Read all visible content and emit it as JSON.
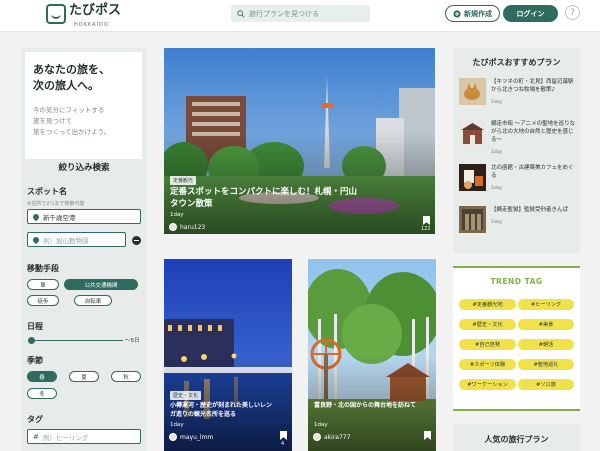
{
  "header": {
    "logo_text": "たびポス",
    "logo_sub": "HOKKAIDO",
    "search_placeholder": "旅行プランを見つける",
    "new_button": "新規作成",
    "login_button": "ログイン",
    "help": "?"
  },
  "sidebar": {
    "intro_title_1": "あなたの旅を、",
    "intro_title_2": "次の旅人へ。",
    "intro_body_1": "今の気分にフィットする",
    "intro_body_2": "旅を見つけて",
    "intro_body_3": "旅をつくって出かけよう。",
    "filter_heading": "絞り込み検索",
    "spot_label": "スポット名",
    "spot_note": "※住所で2つまで検索可能",
    "spot_1_value": "新千歳空港",
    "spot_2_placeholder": "例）旭山動物園",
    "transport_label": "移動手段",
    "transport": [
      "車",
      "公共交通機関",
      "徒歩",
      "自転車"
    ],
    "transport_selected": "公共交通機関",
    "days_label": "日程",
    "days_max": "〜5日",
    "days_value": 1,
    "season_label": "季節",
    "seasons": [
      "春",
      "夏",
      "秋",
      "冬"
    ],
    "season_selected": "春",
    "tag_label": "タグ",
    "tag_placeholder": "例）ヒーリング"
  },
  "featured": {
    "badge": "定番観光",
    "title_1": "定番スポットをコンパクトに楽しむ！札幌・円山",
    "title_2": "タウン散策",
    "days": "1day",
    "user": "haru123",
    "bookmarks": "122"
  },
  "cards": [
    {
      "badge": "歴史・文化",
      "title_1": "小樽運河・歴史が刻まれた美しいレン",
      "title_2": "ガ造りの観光名所を巡る",
      "days": "1day",
      "user": "mayu_lmm",
      "bookmarks": "4"
    },
    {
      "badge": "",
      "title_1": "富良野・北の国からの舞台地を訪ねて",
      "title_2": "",
      "days": "1day",
      "user": "akira777",
      "bookmarks": ""
    }
  ],
  "recommend": {
    "title": "たびポスおすすめプラン",
    "items": [
      {
        "text": "【キツネの町・北見】西留辺蘂駅から北きつね牧場を散策♪",
        "days": "1day"
      },
      {
        "text": "網走市街 〜アニメの聖地を巡りながら北の大地の自然と歴史を感じる〜",
        "days": "1day"
      },
      {
        "text": "北の函館・古建築美カフェをめぐる",
        "days": "1day"
      },
      {
        "text": "【網走監獄】監獄受刑者きんぱ",
        "days": "1day"
      }
    ]
  },
  "trend": {
    "title": "TREND TAG",
    "tags": [
      "#定番観光地",
      "#ヒーリング",
      "#歴史・文化",
      "#美食",
      "#自己啓発",
      "#朝活",
      "#スポーツ体験",
      "#聖地巡礼",
      "#ワーケーション",
      "#ソロ旅"
    ]
  },
  "popular": {
    "title": "人気の旅行プラン"
  },
  "colors": {
    "brand": "#2f6b5e",
    "tag_yellow": "#f2e24a",
    "trend_green": "#7fb23f"
  }
}
